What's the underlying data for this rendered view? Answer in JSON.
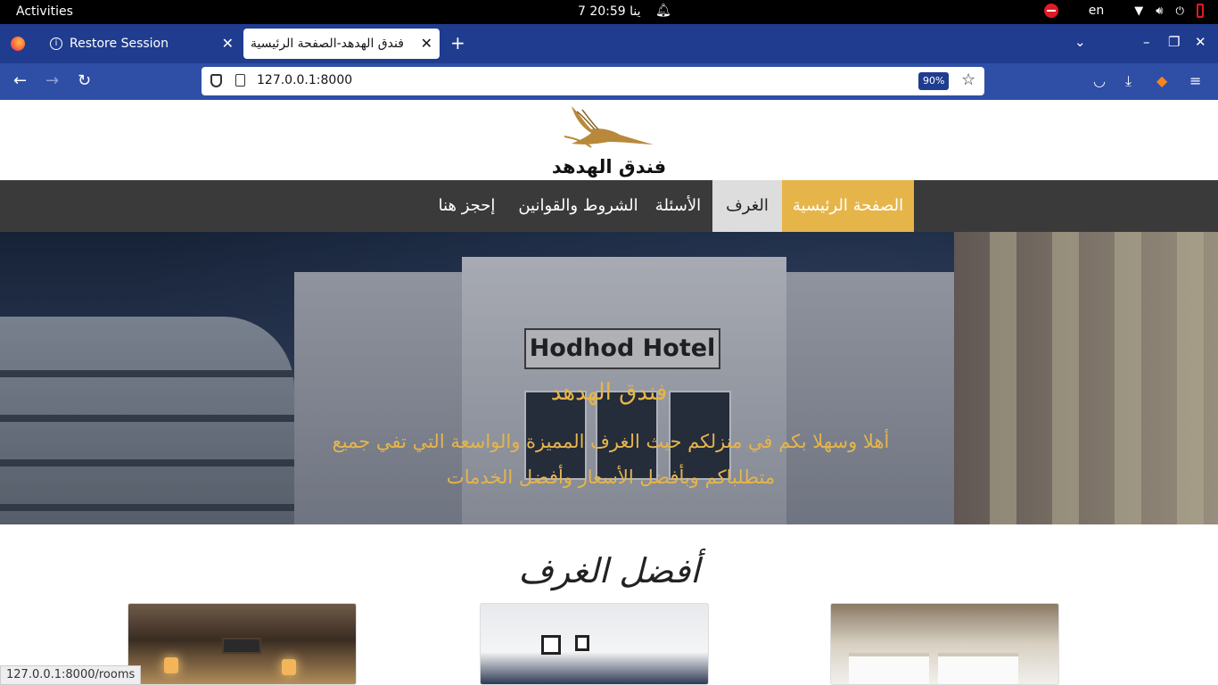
{
  "system": {
    "activities": "Activities",
    "clock": "7 ‏ينا 20:59",
    "language": "en"
  },
  "browser": {
    "tabs": [
      {
        "label": "Restore Session",
        "active": false
      },
      {
        "label": "فندق الهدهد-الصفحة الرئيسية",
        "active": true
      }
    ],
    "url": "127.0.0.1:8000",
    "zoom": "90%",
    "status_url": "127.0.0.1:8000/rooms"
  },
  "site": {
    "brand": "فندق الهدهد",
    "nav": {
      "home": "الصفحة الرئيسية",
      "rooms": "الغرف",
      "faq": "الأسئلة",
      "terms": "الشروط والقوانين",
      "book": "إحجز هنا"
    },
    "hero": {
      "sign": "Hodhod Hotel",
      "title": "فندق الهدهد",
      "subtitle": "أهلا وسهلا بكم في منزلكم حيث الغرف المميزة والواسعة التي تفي جميع متطلباكم وبأفضل الأسعار وأفضل الخدمات"
    },
    "section_title": "أفضل الغرف"
  },
  "colors": {
    "accent": "#e6b54a",
    "nav_bg": "#3a3a3a",
    "browser_blue": "#1f3c8f"
  }
}
